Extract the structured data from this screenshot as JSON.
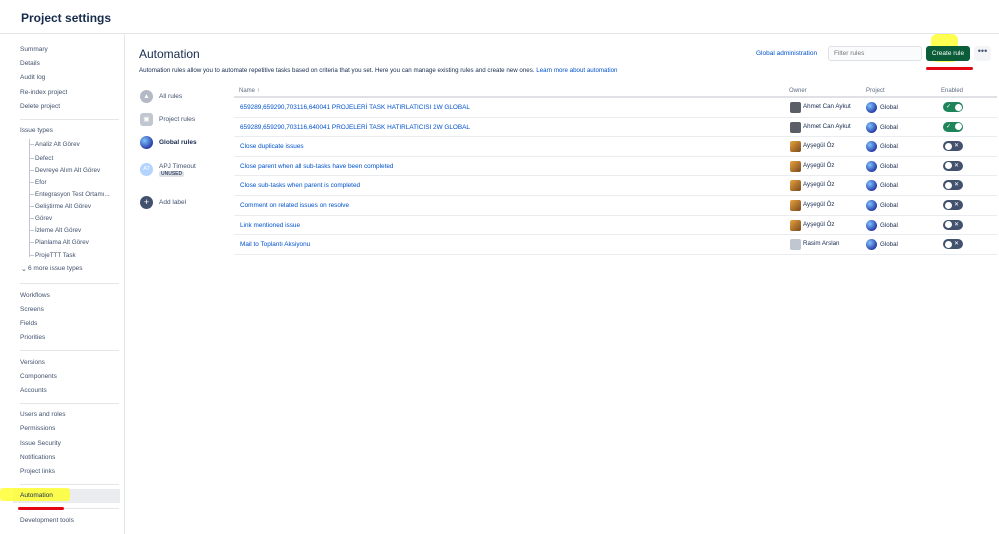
{
  "header": {
    "title": "Project settings"
  },
  "sidebar": {
    "group1": [
      "Summary",
      "Details",
      "Audit log",
      "Re-index project",
      "Delete project"
    ],
    "issue_types_label": "Issue types",
    "issue_types": [
      "Analiz Alt Görev",
      "Defect",
      "Devreye Alım Alt Görev",
      "Efor",
      "Entegrasyon Test Ortamı...",
      "Geliştirme Alt Görev",
      "Görev",
      "İzleme Alt Görev",
      "Planlama Alt Görev",
      "ProjeTTT Task"
    ],
    "more_issue_types": "6 more issue types",
    "group3": [
      "Workflows",
      "Screens",
      "Fields",
      "Priorities"
    ],
    "group4": [
      "Versions",
      "Components",
      "Accounts"
    ],
    "group5": [
      "Users and roles",
      "Permissions",
      "Issue Security",
      "Notifications",
      "Project links"
    ],
    "automation": "Automation",
    "dev_tools": "Development tools"
  },
  "main": {
    "title": "Automation",
    "description": "Automation rules allow you to automate repetitive tasks based on criteria that you set. Here you can manage existing rules and create new ones.",
    "learn_more": "Learn more about automation",
    "global_admin": "Global administration",
    "filter_placeholder": "Filter rules",
    "create_rule": "Create rule",
    "more": "•••"
  },
  "rule_filters": {
    "all": "All rules",
    "project": "Project rules",
    "global": "Global rules",
    "label_name": "APJ Timeout",
    "label_badge": "UNUSED",
    "add_label": "Add label"
  },
  "table": {
    "headers": {
      "name": "Name ↑",
      "owner": "Owner",
      "project": "Project",
      "enabled": "Enabled"
    },
    "rows": [
      {
        "name": "659289,659290,703116,640041 PROJELERİ TASK HATIRLATICISI 1W GLOBAL",
        "owner": "Ahmet Can Aykut",
        "project": "Global",
        "enabled": true
      },
      {
        "name": "659289,659290,703116,640041 PROJELERİ TASK HATIRLATICISI 2W GLOBAL",
        "owner": "Ahmet Can Aykut",
        "project": "Global",
        "enabled": true
      },
      {
        "name": "Close duplicate issues",
        "owner": "Ayşegül Öz",
        "project": "Global",
        "enabled": false
      },
      {
        "name": "Close parent when all sub-tasks have been completed",
        "owner": "Ayşegül Öz",
        "project": "Global",
        "enabled": false
      },
      {
        "name": "Close sub-tasks when parent is completed",
        "owner": "Ayşegül Öz",
        "project": "Global",
        "enabled": false
      },
      {
        "name": "Comment on related issues on resolve",
        "owner": "Ayşegül Öz",
        "project": "Global",
        "enabled": false
      },
      {
        "name": "Link mentioned issue",
        "owner": "Ayşegül Öz",
        "project": "Global",
        "enabled": false
      },
      {
        "name": "Mail to Toplantı Aksiyonu",
        "owner": "Rasim Arslan",
        "project": "Global",
        "enabled": false
      }
    ]
  },
  "colors": {
    "link": "#0052cc",
    "create_button": "#0b5d3a",
    "toggle_on": "#1f845a",
    "toggle_off": "#42526e",
    "highlight": "#ffff33",
    "underline": "#e30613"
  }
}
